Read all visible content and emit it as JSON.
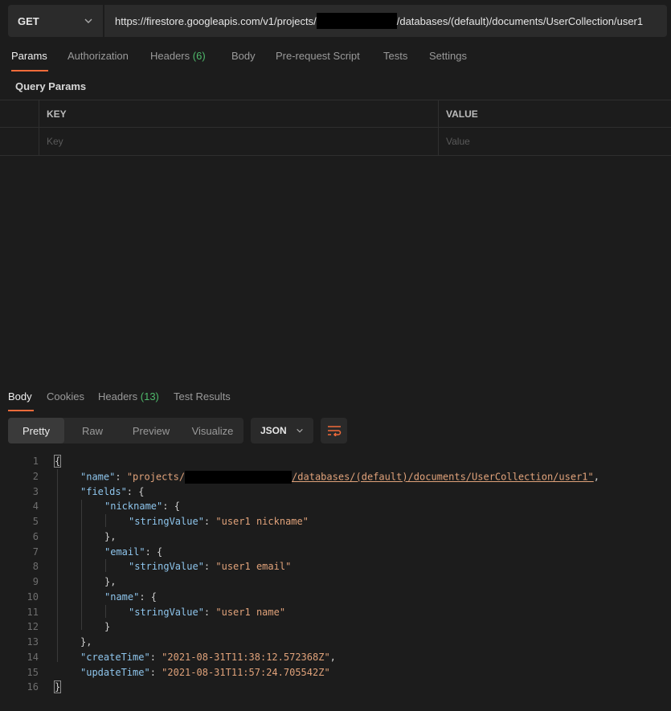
{
  "request": {
    "method": "GET",
    "url_prefix": "https://firestore.googleapis.com/v1/projects/",
    "url_suffix": "/databases/(default)/documents/UserCollection/user1"
  },
  "req_tabs": {
    "params": "Params",
    "authorization": "Authorization",
    "headers": "Headers",
    "headers_count": "(6)",
    "body": "Body",
    "prerequest": "Pre-request Script",
    "tests": "Tests",
    "settings": "Settings"
  },
  "query_params": {
    "title": "Query Params",
    "col_key": "KEY",
    "col_value": "VALUE",
    "key_placeholder": "Key",
    "value_placeholder": "Value"
  },
  "res_tabs": {
    "body": "Body",
    "cookies": "Cookies",
    "headers": "Headers",
    "headers_count": "(13)",
    "test_results": "Test Results"
  },
  "view_modes": [
    "Pretty",
    "Raw",
    "Preview",
    "Visualize"
  ],
  "format": "JSON",
  "code": {
    "line_numbers": [
      "1",
      "2",
      "3",
      "4",
      "5",
      "6",
      "7",
      "8",
      "9",
      "10",
      "11",
      "12",
      "13",
      "14",
      "15",
      "16"
    ],
    "name_key": "\"name\"",
    "name_prefix": "\"projects/",
    "name_suffix": "/databases/(default)/documents/UserCollection/user1\"",
    "fields_key": "\"fields\"",
    "nickname_key": "\"nickname\"",
    "nickname_value": "\"user1 nickname\"",
    "email_key": "\"email\"",
    "email_value": "\"user1 email\"",
    "inner_name_key": "\"name\"",
    "name_value": "\"user1 name\"",
    "string_value_key": "\"stringValue\"",
    "create_key": "\"createTime\"",
    "create_value": "\"2021-08-31T11:38:12.572368Z\"",
    "update_key": "\"updateTime\"",
    "update_value": "\"2021-08-31T11:57:24.705542Z\""
  },
  "colors": {
    "background": "#1c1c1c",
    "accent": "#f26b3a",
    "count_green": "#4fb96b",
    "json_key": "#8ec5ec",
    "json_string": "#e0a27a"
  }
}
